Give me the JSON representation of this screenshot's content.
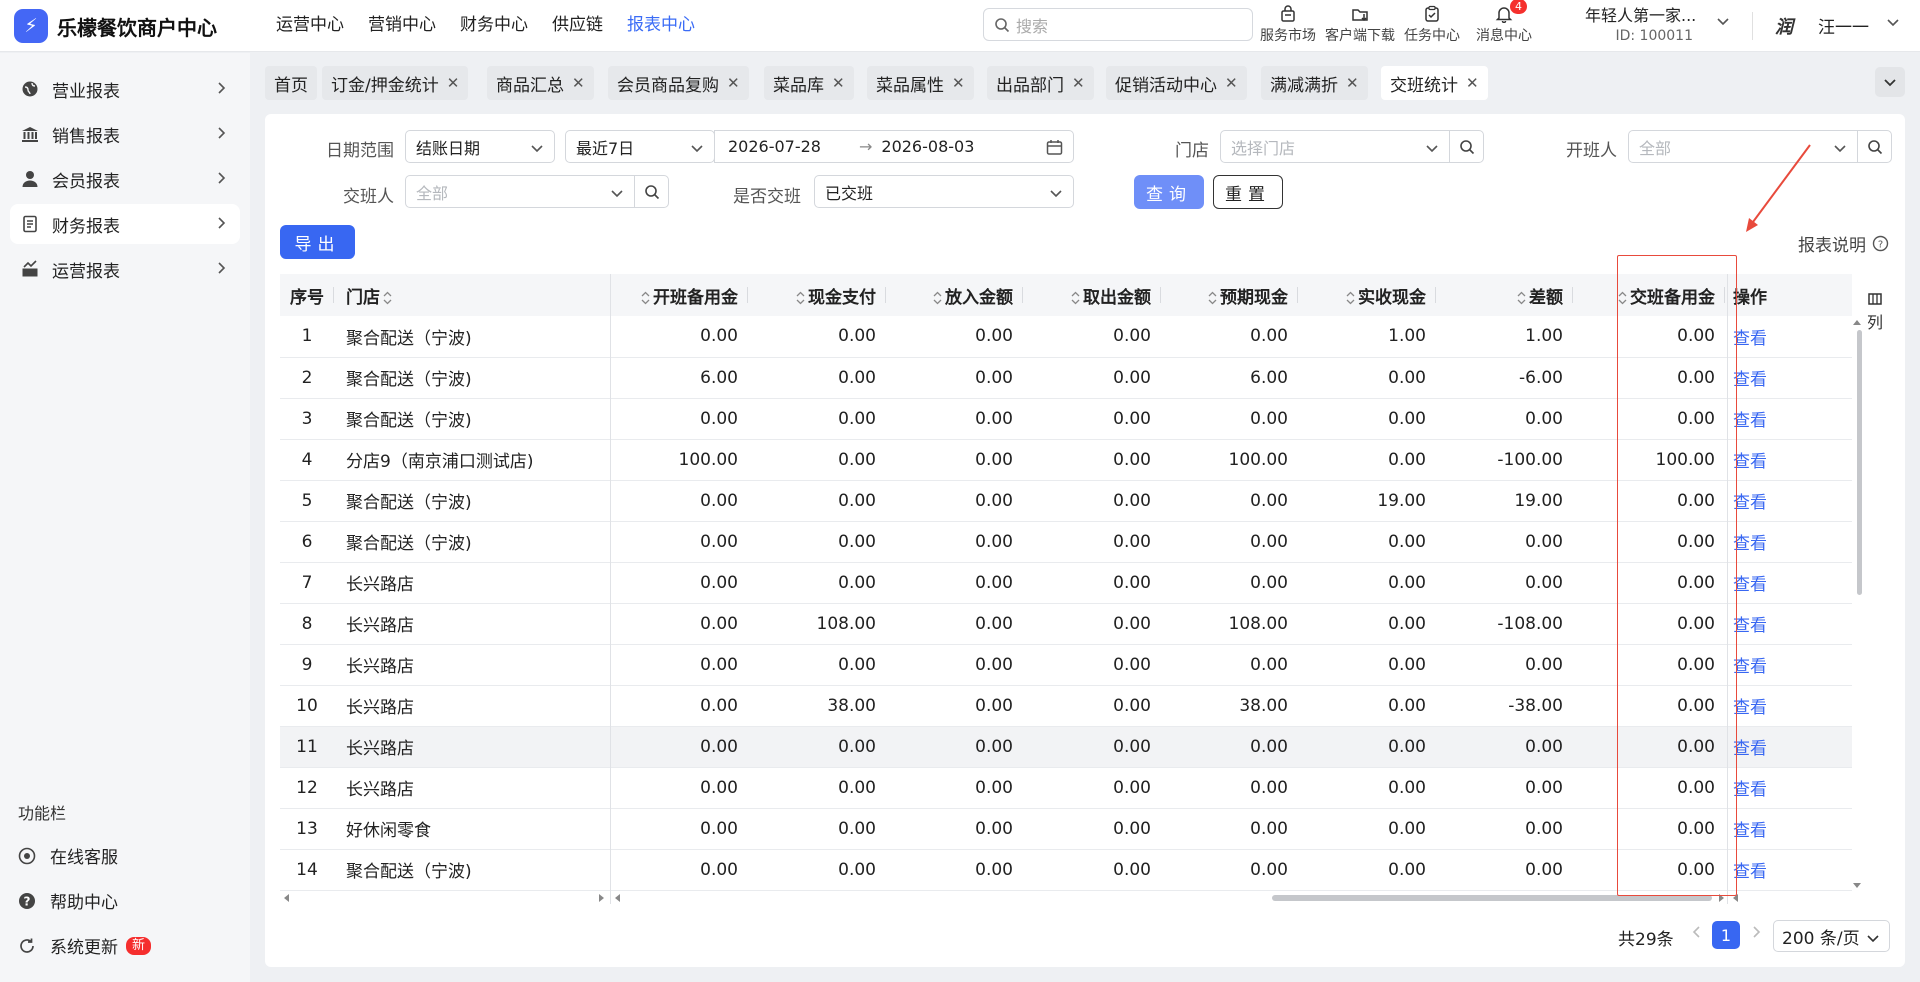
{
  "app": {
    "logo_mark": "⚡",
    "title": "乐檬餐饮商户中心"
  },
  "topnav": [
    "运营中心",
    "营销中心",
    "财务中心",
    "供应链",
    "报表中心"
  ],
  "search": {
    "placeholder": "搜索"
  },
  "tools": [
    {
      "label": "服务市场",
      "icon": "store-icon"
    },
    {
      "label": "客户端下载",
      "icon": "download-icon"
    },
    {
      "label": "任务中心",
      "icon": "task-icon"
    },
    {
      "label": "消息中心",
      "icon": "bell-icon",
      "badge": "4"
    }
  ],
  "account": {
    "name": "年轻人第一家...",
    "id": "ID: 100011"
  },
  "user": {
    "avatar_text": "润",
    "name": "汪一一"
  },
  "sidebar": {
    "items": [
      {
        "label": "营业报表",
        "icon": "globe-icon"
      },
      {
        "label": "销售报表",
        "icon": "bank-icon"
      },
      {
        "label": "会员报表",
        "icon": "user-icon"
      },
      {
        "label": "财务报表",
        "icon": "ledger-icon"
      },
      {
        "label": "运营报表",
        "icon": "chart-icon"
      }
    ],
    "func_title": "功能栏",
    "func_items": [
      {
        "label": "在线客服",
        "icon": "headset-icon"
      },
      {
        "label": "帮助中心",
        "icon": "help-icon"
      },
      {
        "label": "系统更新",
        "icon": "refresh-icon",
        "badge": "新"
      }
    ]
  },
  "tabs": [
    {
      "label": "首页",
      "closable": false
    },
    {
      "label": "订金/押金统计",
      "closable": true
    },
    {
      "label": "商品汇总",
      "closable": true
    },
    {
      "label": "会员商品复购",
      "closable": true
    },
    {
      "label": "菜品库",
      "closable": true
    },
    {
      "label": "菜品属性",
      "closable": true
    },
    {
      "label": "出品部门",
      "closable": true
    },
    {
      "label": "促销活动中心",
      "closable": true
    },
    {
      "label": "满减满折",
      "closable": true
    },
    {
      "label": "交班统计",
      "closable": true,
      "active": true
    }
  ],
  "filters": {
    "date_range_label": "日期范围",
    "date_type": "结账日期",
    "date_preset": "最近7日",
    "date_start": "2026-07-28",
    "date_end": "2026-08-03",
    "date_sep": "→",
    "store_label": "门店",
    "store_placeholder": "选择门店",
    "opener_label": "开班人",
    "opener_placeholder": "全部",
    "handover_label": "交班人",
    "handover_placeholder": "全部",
    "is_handover_label": "是否交班",
    "is_handover_value": "已交班",
    "query_button": "查询",
    "reset_button": "重置"
  },
  "export_button": "导出",
  "report_note": "报表说明",
  "table": {
    "columns": [
      "序号",
      "门店",
      "开班备用金",
      "现金支付",
      "放入金额",
      "取出金额",
      "预期现金",
      "实收现金",
      "差额",
      "交班备用金",
      "操作"
    ],
    "column_settings": "列",
    "action_label": "查看",
    "rows": [
      [
        "1",
        "聚合配送（宁波)",
        "0.00",
        "0.00",
        "0.00",
        "0.00",
        "0.00",
        "1.00",
        "1.00",
        "0.00"
      ],
      [
        "2",
        "聚合配送（宁波)",
        "6.00",
        "0.00",
        "0.00",
        "0.00",
        "6.00",
        "0.00",
        "-6.00",
        "0.00"
      ],
      [
        "3",
        "聚合配送（宁波)",
        "0.00",
        "0.00",
        "0.00",
        "0.00",
        "0.00",
        "0.00",
        "0.00",
        "0.00"
      ],
      [
        "4",
        "分店9（南京浦口测试店)",
        "100.00",
        "0.00",
        "0.00",
        "0.00",
        "100.00",
        "0.00",
        "-100.00",
        "100.00"
      ],
      [
        "5",
        "聚合配送（宁波)",
        "0.00",
        "0.00",
        "0.00",
        "0.00",
        "0.00",
        "19.00",
        "19.00",
        "0.00"
      ],
      [
        "6",
        "聚合配送（宁波)",
        "0.00",
        "0.00",
        "0.00",
        "0.00",
        "0.00",
        "0.00",
        "0.00",
        "0.00"
      ],
      [
        "7",
        "长兴路店",
        "0.00",
        "0.00",
        "0.00",
        "0.00",
        "0.00",
        "0.00",
        "0.00",
        "0.00"
      ],
      [
        "8",
        "长兴路店",
        "0.00",
        "108.00",
        "0.00",
        "0.00",
        "108.00",
        "0.00",
        "-108.00",
        "0.00"
      ],
      [
        "9",
        "长兴路店",
        "0.00",
        "0.00",
        "0.00",
        "0.00",
        "0.00",
        "0.00",
        "0.00",
        "0.00"
      ],
      [
        "10",
        "长兴路店",
        "0.00",
        "38.00",
        "0.00",
        "0.00",
        "38.00",
        "0.00",
        "-38.00",
        "0.00"
      ],
      [
        "11",
        "长兴路店",
        "0.00",
        "0.00",
        "0.00",
        "0.00",
        "0.00",
        "0.00",
        "0.00",
        "0.00"
      ],
      [
        "12",
        "长兴路店",
        "0.00",
        "0.00",
        "0.00",
        "0.00",
        "0.00",
        "0.00",
        "0.00",
        "0.00"
      ],
      [
        "13",
        "好休闲零食",
        "0.00",
        "0.00",
        "0.00",
        "0.00",
        "0.00",
        "0.00",
        "0.00",
        "0.00"
      ],
      [
        "14",
        "聚合配送（宁波)",
        "0.00",
        "0.00",
        "0.00",
        "0.00",
        "0.00",
        "0.00",
        "0.00",
        "0.00"
      ]
    ]
  },
  "pagination": {
    "total": "共29条",
    "current": "1",
    "page_size": "200 条/页"
  },
  "colors": {
    "accent": "#3867f2",
    "annotation": "#e84a3c"
  }
}
